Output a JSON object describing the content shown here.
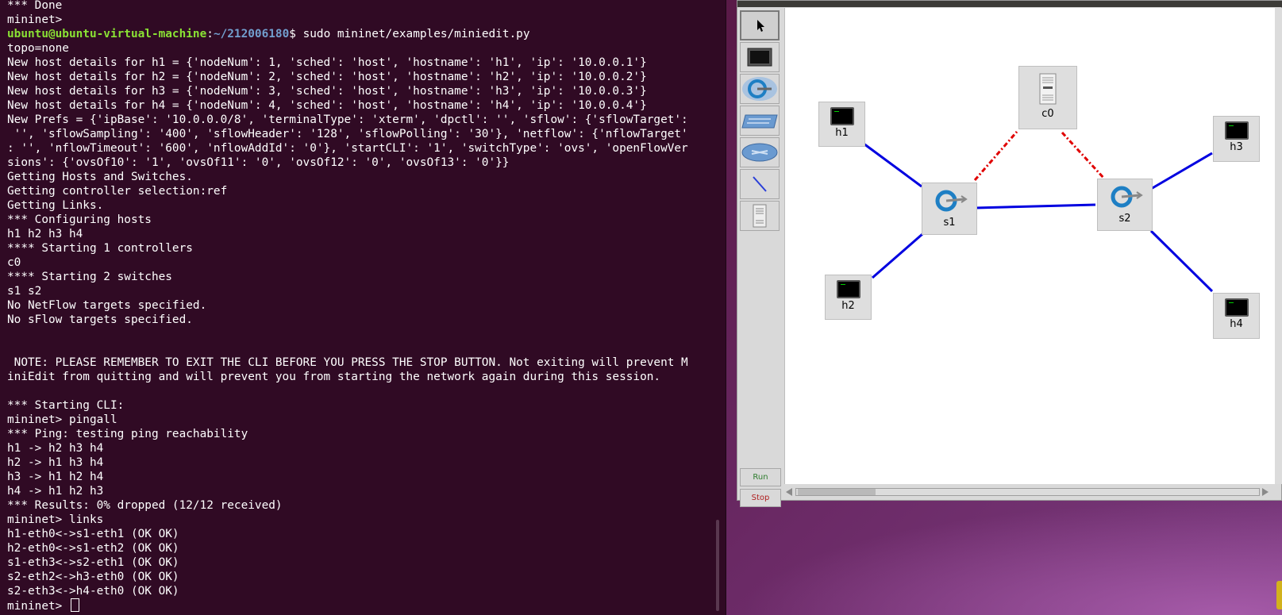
{
  "terminal": {
    "prompt_user": "ubuntu@ubuntu-virtual-machine",
    "prompt_path": "~/212006180",
    "lines": [
      {
        "text": "*** Done"
      },
      {
        "text": "mininet>"
      },
      {
        "prompt": true,
        "cmd": "$ sudo mininet/examples/miniedit.py"
      },
      {
        "text": "topo=none"
      },
      {
        "text": "New host details for h1 = {'nodeNum': 1, 'sched': 'host', 'hostname': 'h1', 'ip': '10.0.0.1'}"
      },
      {
        "text": "New host details for h2 = {'nodeNum': 2, 'sched': 'host', 'hostname': 'h2', 'ip': '10.0.0.2'}"
      },
      {
        "text": "New host details for h3 = {'nodeNum': 3, 'sched': 'host', 'hostname': 'h3', 'ip': '10.0.0.3'}"
      },
      {
        "text": "New host details for h4 = {'nodeNum': 4, 'sched': 'host', 'hostname': 'h4', 'ip': '10.0.0.4'}"
      },
      {
        "text": "New Prefs = {'ipBase': '10.0.0.0/8', 'terminalType': 'xterm', 'dpctl': '', 'sflow': {'sflowTarget':"
      },
      {
        "text": " '', 'sflowSampling': '400', 'sflowHeader': '128', 'sflowPolling': '30'}, 'netflow': {'nflowTarget'"
      },
      {
        "text": ": '', 'nflowTimeout': '600', 'nflowAddId': '0'}, 'startCLI': '1', 'switchType': 'ovs', 'openFlowVer"
      },
      {
        "text": "sions': {'ovsOf10': '1', 'ovsOf11': '0', 'ovsOf12': '0', 'ovsOf13': '0'}}"
      },
      {
        "text": "Getting Hosts and Switches."
      },
      {
        "text": "Getting controller selection:ref"
      },
      {
        "text": "Getting Links."
      },
      {
        "text": "*** Configuring hosts"
      },
      {
        "text": "h1 h2 h3 h4"
      },
      {
        "text": "**** Starting 1 controllers"
      },
      {
        "text": "c0"
      },
      {
        "text": "**** Starting 2 switches"
      },
      {
        "text": "s1 s2"
      },
      {
        "text": "No NetFlow targets specified."
      },
      {
        "text": "No sFlow targets specified."
      },
      {
        "text": ""
      },
      {
        "text": ""
      },
      {
        "text": " NOTE: PLEASE REMEMBER TO EXIT THE CLI BEFORE YOU PRESS THE STOP BUTTON. Not exiting will prevent M"
      },
      {
        "text": "iniEdit from quitting and will prevent you from starting the network again during this session."
      },
      {
        "text": ""
      },
      {
        "text": "*** Starting CLI:"
      },
      {
        "text": "mininet> pingall"
      },
      {
        "text": "*** Ping: testing ping reachability"
      },
      {
        "text": "h1 -> h2 h3 h4"
      },
      {
        "text": "h2 -> h1 h3 h4"
      },
      {
        "text": "h3 -> h1 h2 h4"
      },
      {
        "text": "h4 -> h1 h2 h3"
      },
      {
        "text": "*** Results: 0% dropped (12/12 received)"
      },
      {
        "text": "mininet> links"
      },
      {
        "text": "h1-eth0<->s1-eth1 (OK OK)"
      },
      {
        "text": "h2-eth0<->s1-eth2 (OK OK)"
      },
      {
        "text": "s1-eth3<->s2-eth1 (OK OK)"
      },
      {
        "text": "s2-eth2<->h3-eth0 (OK OK)"
      },
      {
        "text": "s2-eth3<->h4-eth0 (OK OK)"
      },
      {
        "text": "mininet> ",
        "cursor": true
      }
    ]
  },
  "miniedit": {
    "tools": [
      {
        "name": "select-tool",
        "icon": "pointer-arrow-icon"
      },
      {
        "name": "host-tool",
        "icon": "host-monitor-icon"
      },
      {
        "name": "switch-tool",
        "icon": "switch-icon"
      },
      {
        "name": "legacy-switch-tool",
        "icon": "legacy-switch-icon"
      },
      {
        "name": "legacy-router-tool",
        "icon": "router-icon"
      },
      {
        "name": "link-tool",
        "icon": "netlink-icon"
      },
      {
        "name": "controller-tool",
        "icon": "controller-icon"
      }
    ],
    "run_label": "Run",
    "stop_label": "Stop",
    "colors": {
      "data_link": "#0000e0",
      "controller_link": "#e00000",
      "switch_blue": "#1e7fc4"
    },
    "nodes": [
      {
        "id": "h1",
        "label": "h1",
        "kind": "host"
      },
      {
        "id": "h2",
        "label": "h2",
        "kind": "host"
      },
      {
        "id": "h3",
        "label": "h3",
        "kind": "host"
      },
      {
        "id": "h4",
        "label": "h4",
        "kind": "host"
      },
      {
        "id": "s1",
        "label": "s1",
        "kind": "switch"
      },
      {
        "id": "s2",
        "label": "s2",
        "kind": "switch"
      },
      {
        "id": "c0",
        "label": "c0",
        "kind": "controller"
      }
    ],
    "links": [
      {
        "from": "h1",
        "to": "s1",
        "type": "data"
      },
      {
        "from": "h2",
        "to": "s1",
        "type": "data"
      },
      {
        "from": "s1",
        "to": "s2",
        "type": "data"
      },
      {
        "from": "s2",
        "to": "h3",
        "type": "data"
      },
      {
        "from": "s2",
        "to": "h4",
        "type": "data"
      },
      {
        "from": "c0",
        "to": "s1",
        "type": "control"
      },
      {
        "from": "c0",
        "to": "s2",
        "type": "control"
      }
    ]
  }
}
